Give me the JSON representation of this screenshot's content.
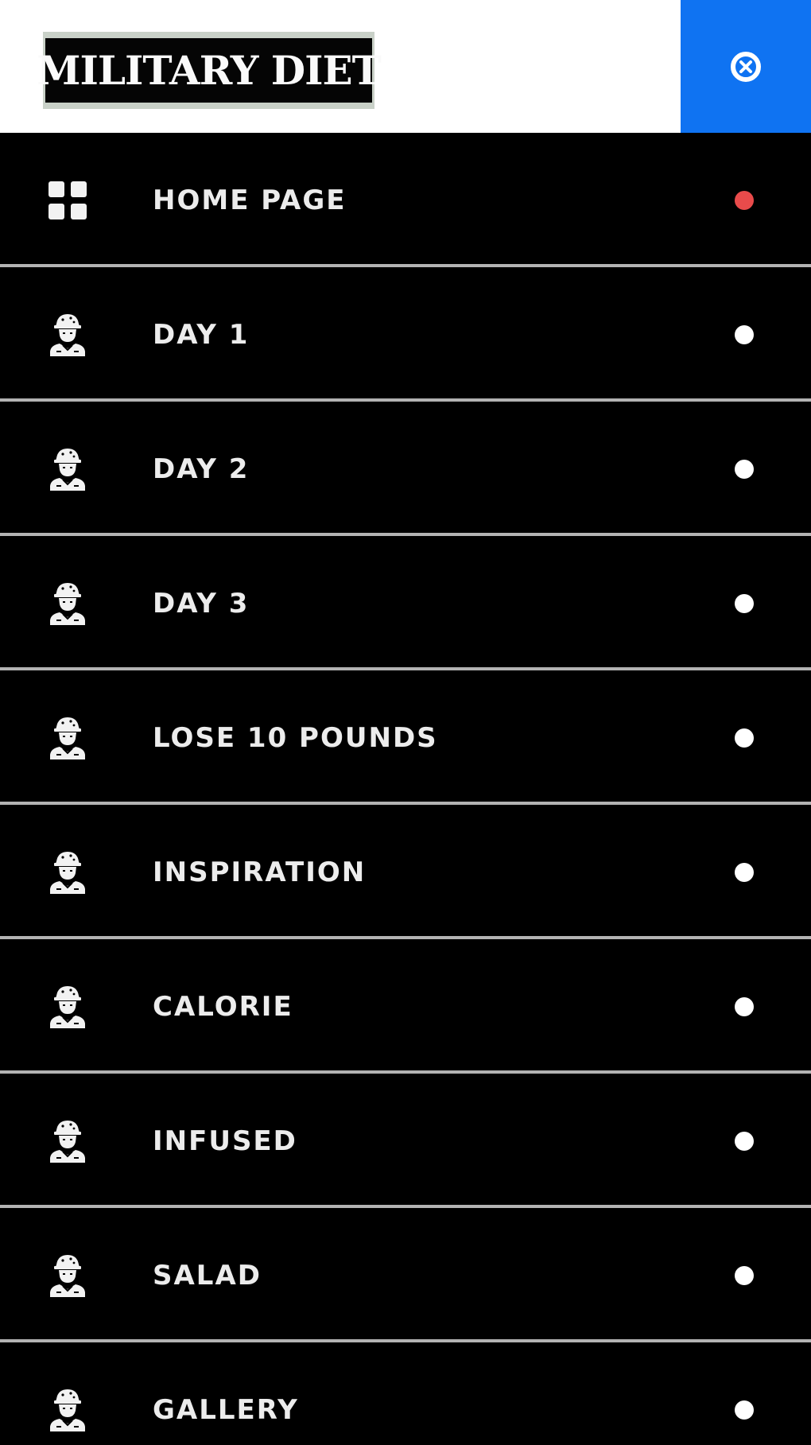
{
  "header": {
    "logo_text": "MILITARY DIET",
    "close_icon": "close-circle-icon",
    "accent_color": "#0f73f2"
  },
  "menu": {
    "active_dot_color": "#e94b4b",
    "inactive_dot_color": "#ffffff",
    "items": [
      {
        "label": "HOME PAGE",
        "icon": "grid-icon",
        "active": true
      },
      {
        "label": "DAY 1",
        "icon": "soldier-icon",
        "active": false
      },
      {
        "label": "DAY 2",
        "icon": "soldier-icon",
        "active": false
      },
      {
        "label": "DAY 3",
        "icon": "soldier-icon",
        "active": false
      },
      {
        "label": "LOSE 10 POUNDS",
        "icon": "soldier-icon",
        "active": false
      },
      {
        "label": "INSPIRATION",
        "icon": "soldier-icon",
        "active": false
      },
      {
        "label": "CALORIE",
        "icon": "soldier-icon",
        "active": false
      },
      {
        "label": "INFUSED",
        "icon": "soldier-icon",
        "active": false
      },
      {
        "label": "SALAD",
        "icon": "soldier-icon",
        "active": false
      },
      {
        "label": "GALLERY",
        "icon": "soldier-icon",
        "active": false
      }
    ]
  }
}
